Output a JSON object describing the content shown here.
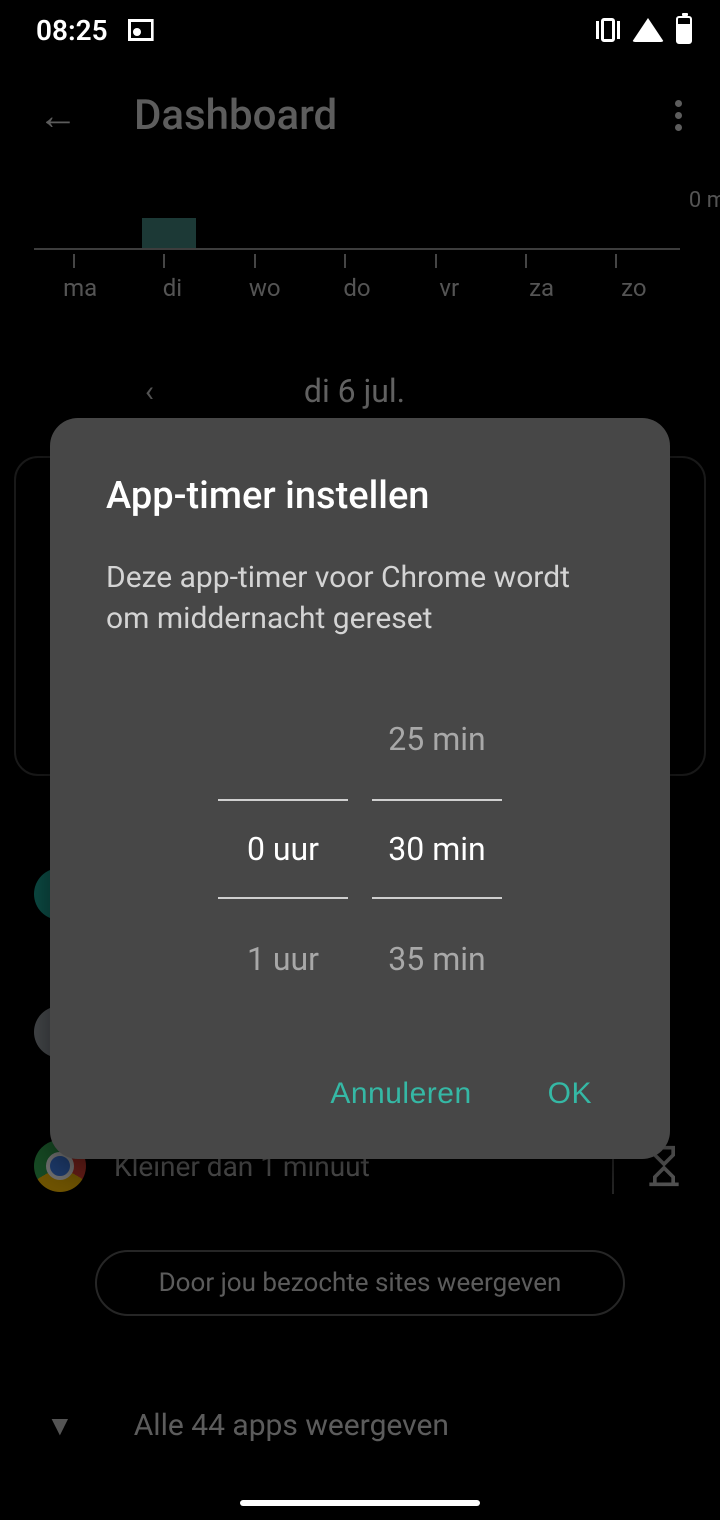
{
  "status": {
    "time": "08:25"
  },
  "appbar": {
    "title": "Dashboard"
  },
  "chart": {
    "zero_label": "0 m",
    "days": [
      "ma",
      "di",
      "wo",
      "do",
      "vr",
      "za",
      "zo"
    ]
  },
  "date": {
    "label": "di 6 jul."
  },
  "app_rows": {
    "chrome_sub": "Kleiner dan 1 minuut"
  },
  "chip": {
    "label": "Door jou bezochte sites weergeven"
  },
  "all_apps": {
    "label": "Alle 44 apps weergeven"
  },
  "dialog": {
    "title": "App-timer instellen",
    "message": "Deze app-timer voor Chrome wordt om middernacht gereset",
    "hours": {
      "prev": "",
      "selected": "0 uur",
      "next": "1 uur"
    },
    "minutes": {
      "prev": "25 min",
      "selected": "30 min",
      "next": "35 min"
    },
    "cancel": "Annuleren",
    "ok": "OK"
  }
}
